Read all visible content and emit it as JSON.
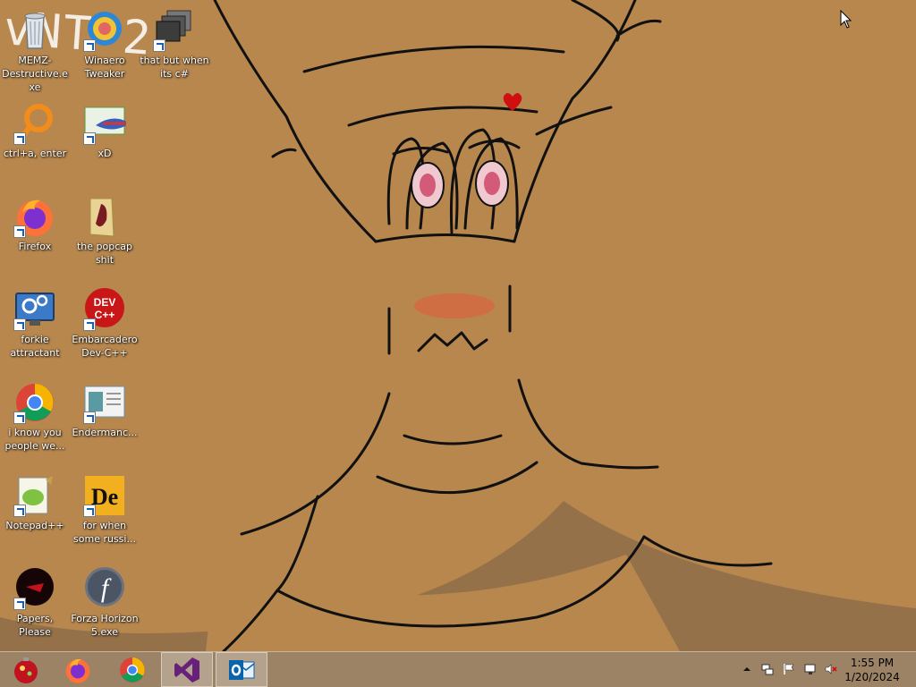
{
  "desktop": {
    "icons": [
      {
        "label": "MEMZ-Destructive.exe",
        "icon": "recycle-bin-icon",
        "shortcut": false
      },
      {
        "label": "Winaero Tweaker",
        "icon": "winaero-icon",
        "shortcut": true
      },
      {
        "label": "that but when its c#",
        "icon": "stacked-windows-icon",
        "shortcut": true
      },
      {
        "label": "ctrl+a, enter",
        "icon": "ring-icon",
        "shortcut": true
      },
      {
        "label": "xD",
        "icon": "hxd-fish-icon",
        "shortcut": true
      },
      {
        "label": "Firefox",
        "icon": "firefox-icon",
        "shortcut": true
      },
      {
        "label": "the popcap shit",
        "icon": "folder-icon",
        "shortcut": false
      },
      {
        "label": "forkie attractant",
        "icon": "gear-monitor-icon",
        "shortcut": true
      },
      {
        "label": "Embarcadero Dev-C++",
        "icon": "devcpp-icon",
        "shortcut": true
      },
      {
        "label": "i know you people we...",
        "icon": "chrome-icon",
        "shortcut": true
      },
      {
        "label": "Endermanc...",
        "icon": "window-app-icon",
        "shortcut": true
      },
      {
        "label": "Notepad++",
        "icon": "notepadpp-icon",
        "shortcut": true
      },
      {
        "label": "for when some russi...",
        "icon": "de-logo-icon",
        "shortcut": true
      },
      {
        "label": "Papers, Please",
        "icon": "papers-please-icon",
        "shortcut": true
      },
      {
        "label": "Forza Horizon 5.exe",
        "icon": "flash-icon",
        "shortcut": false
      }
    ],
    "watermark": "vNT-2"
  },
  "taskbar": {
    "pinned": [
      {
        "name": "start",
        "icon": "ornament-start-icon"
      },
      {
        "name": "firefox",
        "icon": "firefox-icon"
      },
      {
        "name": "chrome",
        "icon": "chrome-icon"
      },
      {
        "name": "visual-studio",
        "icon": "visual-studio-icon",
        "active": true
      },
      {
        "name": "outlook",
        "icon": "outlook-icon",
        "active": true
      }
    ],
    "tray": {
      "icons": [
        "chevron-up-icon",
        "network-adapter-icon",
        "flag-icon",
        "network-icon",
        "volume-muted-icon"
      ]
    },
    "clock": {
      "time": "1:55 PM",
      "date": "1/20/2024"
    }
  },
  "colors": {
    "wallpaper": "#b7874e",
    "taskbar": "#9c8366"
  }
}
